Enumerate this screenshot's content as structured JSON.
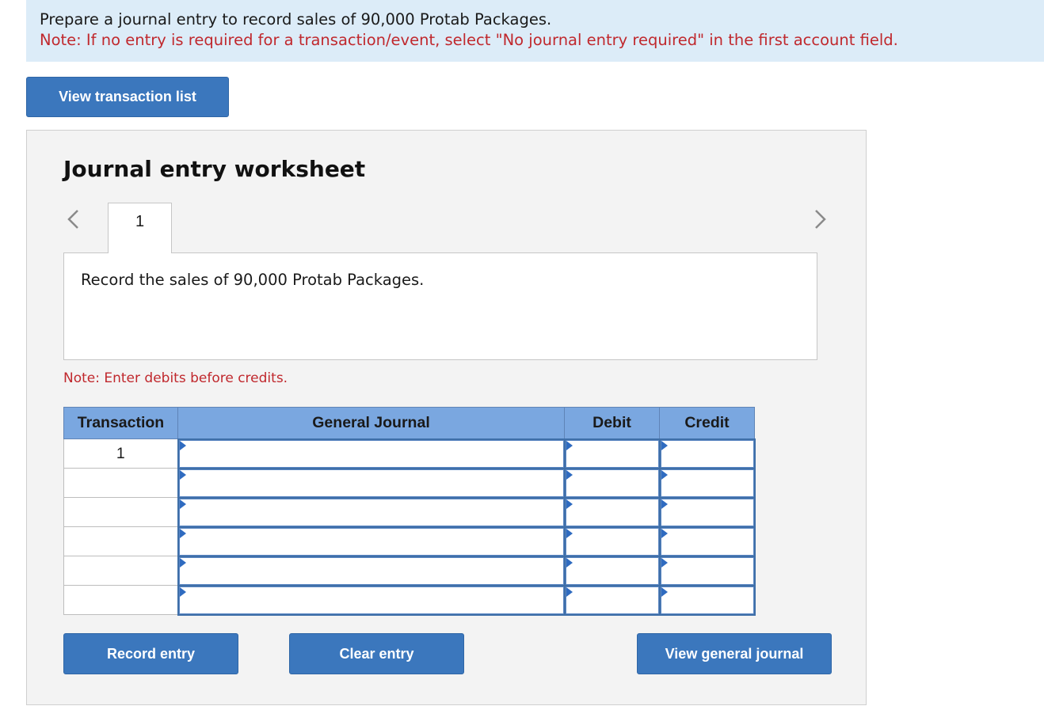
{
  "instructions": {
    "line1": "Prepare a journal entry to record sales of 90,000 Protab Packages.",
    "line2": "Note: If no entry is required for a transaction/event, select \"No journal entry required\" in the first account field."
  },
  "buttons": {
    "view_transaction_list": "View transaction list",
    "record_entry": "Record entry",
    "clear_entry": "Clear entry",
    "view_general_journal": "View general journal"
  },
  "worksheet": {
    "title": "Journal entry worksheet",
    "active_tab": "1",
    "description": "Record the sales of 90,000 Protab Packages.",
    "note": "Note: Enter debits before credits."
  },
  "table": {
    "headers": {
      "transaction": "Transaction",
      "general_journal": "General Journal",
      "debit": "Debit",
      "credit": "Credit"
    },
    "rows": [
      {
        "transaction": "1",
        "account": "",
        "debit": "",
        "credit": ""
      },
      {
        "transaction": "",
        "account": "",
        "debit": "",
        "credit": ""
      },
      {
        "transaction": "",
        "account": "",
        "debit": "",
        "credit": ""
      },
      {
        "transaction": "",
        "account": "",
        "debit": "",
        "credit": ""
      },
      {
        "transaction": "",
        "account": "",
        "debit": "",
        "credit": ""
      },
      {
        "transaction": "",
        "account": "",
        "debit": "",
        "credit": ""
      }
    ]
  },
  "colors": {
    "accent_button": "#3b77bd",
    "instruction_bg": "#dcecf8",
    "note_red": "#c0282d",
    "table_header": "#7aa7e0"
  },
  "icons": {
    "prev": "chevron-left-icon",
    "next": "chevron-right-icon",
    "dropdown_marker": "dropdown-triangle-icon"
  }
}
